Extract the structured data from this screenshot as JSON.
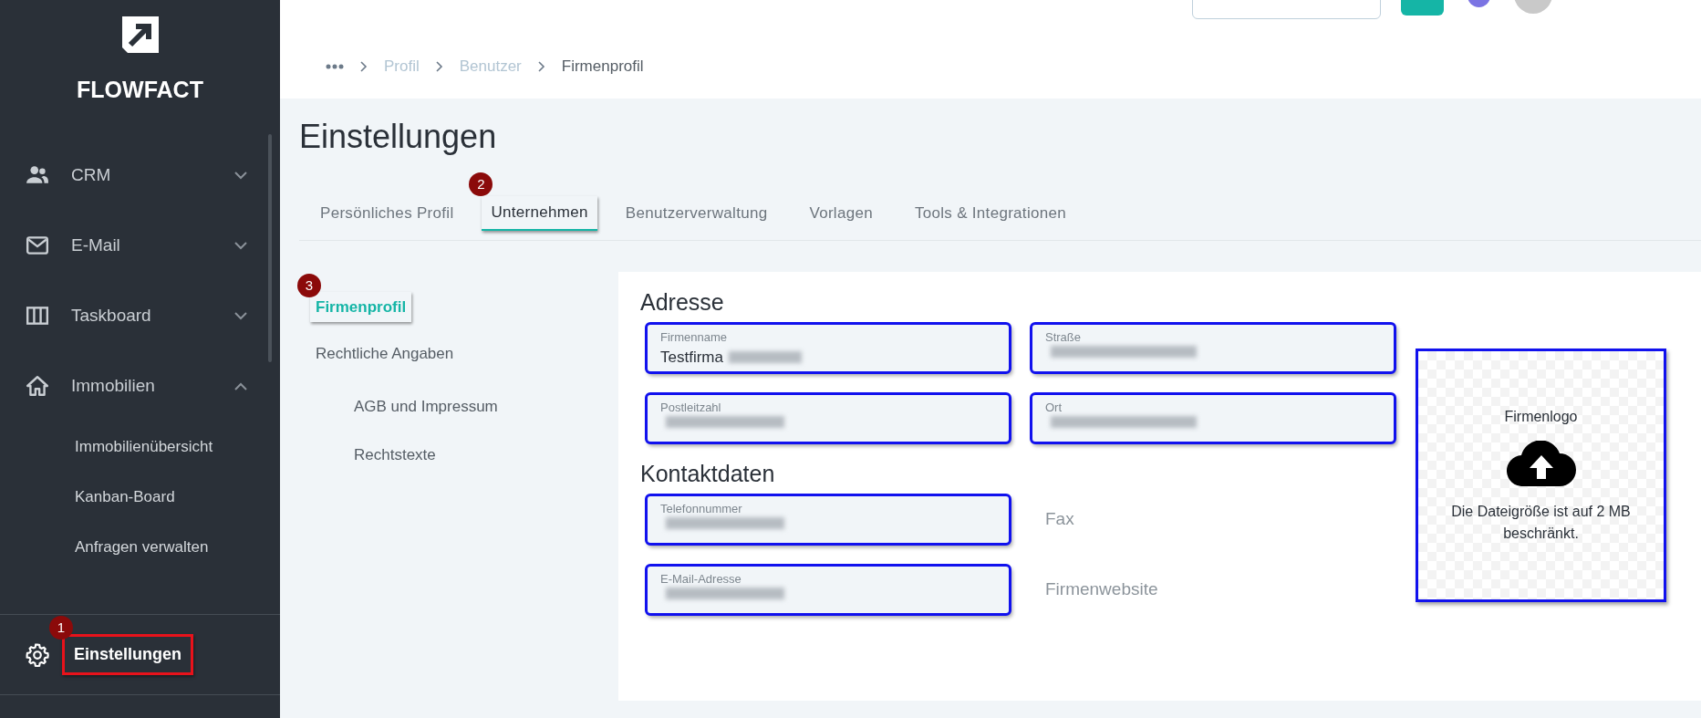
{
  "sidebar": {
    "logo": "FLOWFACT",
    "items": [
      {
        "label": "CRM",
        "expanded": false
      },
      {
        "label": "E-Mail",
        "expanded": false
      },
      {
        "label": "Taskboard",
        "expanded": false
      },
      {
        "label": "Immobilien",
        "expanded": true,
        "children": [
          {
            "label": "Immobilienübersicht"
          },
          {
            "label": "Kanban-Board"
          },
          {
            "label": "Anfragen verwalten"
          }
        ]
      }
    ],
    "footer": {
      "label": "Einstellungen",
      "callout": "1"
    }
  },
  "breadcrumb": [
    {
      "label": "Profil",
      "current": false
    },
    {
      "label": "Benutzer",
      "current": false
    },
    {
      "label": "Firmenprofil",
      "current": true
    }
  ],
  "page_title": "Einstellungen",
  "tabs": [
    {
      "label": "Persönliches Profil",
      "selected": false
    },
    {
      "label": "Unternehmen",
      "selected": true,
      "callout": "2"
    },
    {
      "label": "Benutzerverwaltung",
      "selected": false
    },
    {
      "label": "Vorlagen",
      "selected": false
    },
    {
      "label": "Tools & Integrationen",
      "selected": false
    }
  ],
  "subnav": [
    {
      "label": "Firmenprofil",
      "selected": true,
      "callout": "3"
    },
    {
      "label": "Rechtliche Angaben",
      "selected": false,
      "children": [
        {
          "label": "AGB und Impressum",
          "selected": false
        },
        {
          "label": "Rechtstexte",
          "selected": false
        }
      ]
    }
  ],
  "sections": [
    {
      "title": "Adresse",
      "fields": [
        {
          "label": "Firmenname",
          "value": "Testfirma",
          "redacted": true,
          "highlighted": true
        },
        {
          "label": "Straße",
          "redacted": true,
          "highlighted": true
        },
        {
          "label": "Postleitzahl",
          "redacted": true,
          "highlighted": true
        },
        {
          "label": "Ort",
          "redacted": true,
          "highlighted": true
        }
      ]
    },
    {
      "title": "Kontaktdaten",
      "fields": [
        {
          "label": "Telefonnummer",
          "redacted": true,
          "highlighted": true
        },
        {
          "placeholder": "Fax",
          "highlighted": false
        },
        {
          "label": "E-Mail-Adresse",
          "redacted": true,
          "highlighted": true
        },
        {
          "placeholder": "Firmenwebsite",
          "highlighted": false
        }
      ]
    }
  ],
  "logo_upload": {
    "title": "Firmenlogo",
    "note": "Die Dateigröße ist auf 2 MB beschränkt.",
    "highlighted": true
  }
}
